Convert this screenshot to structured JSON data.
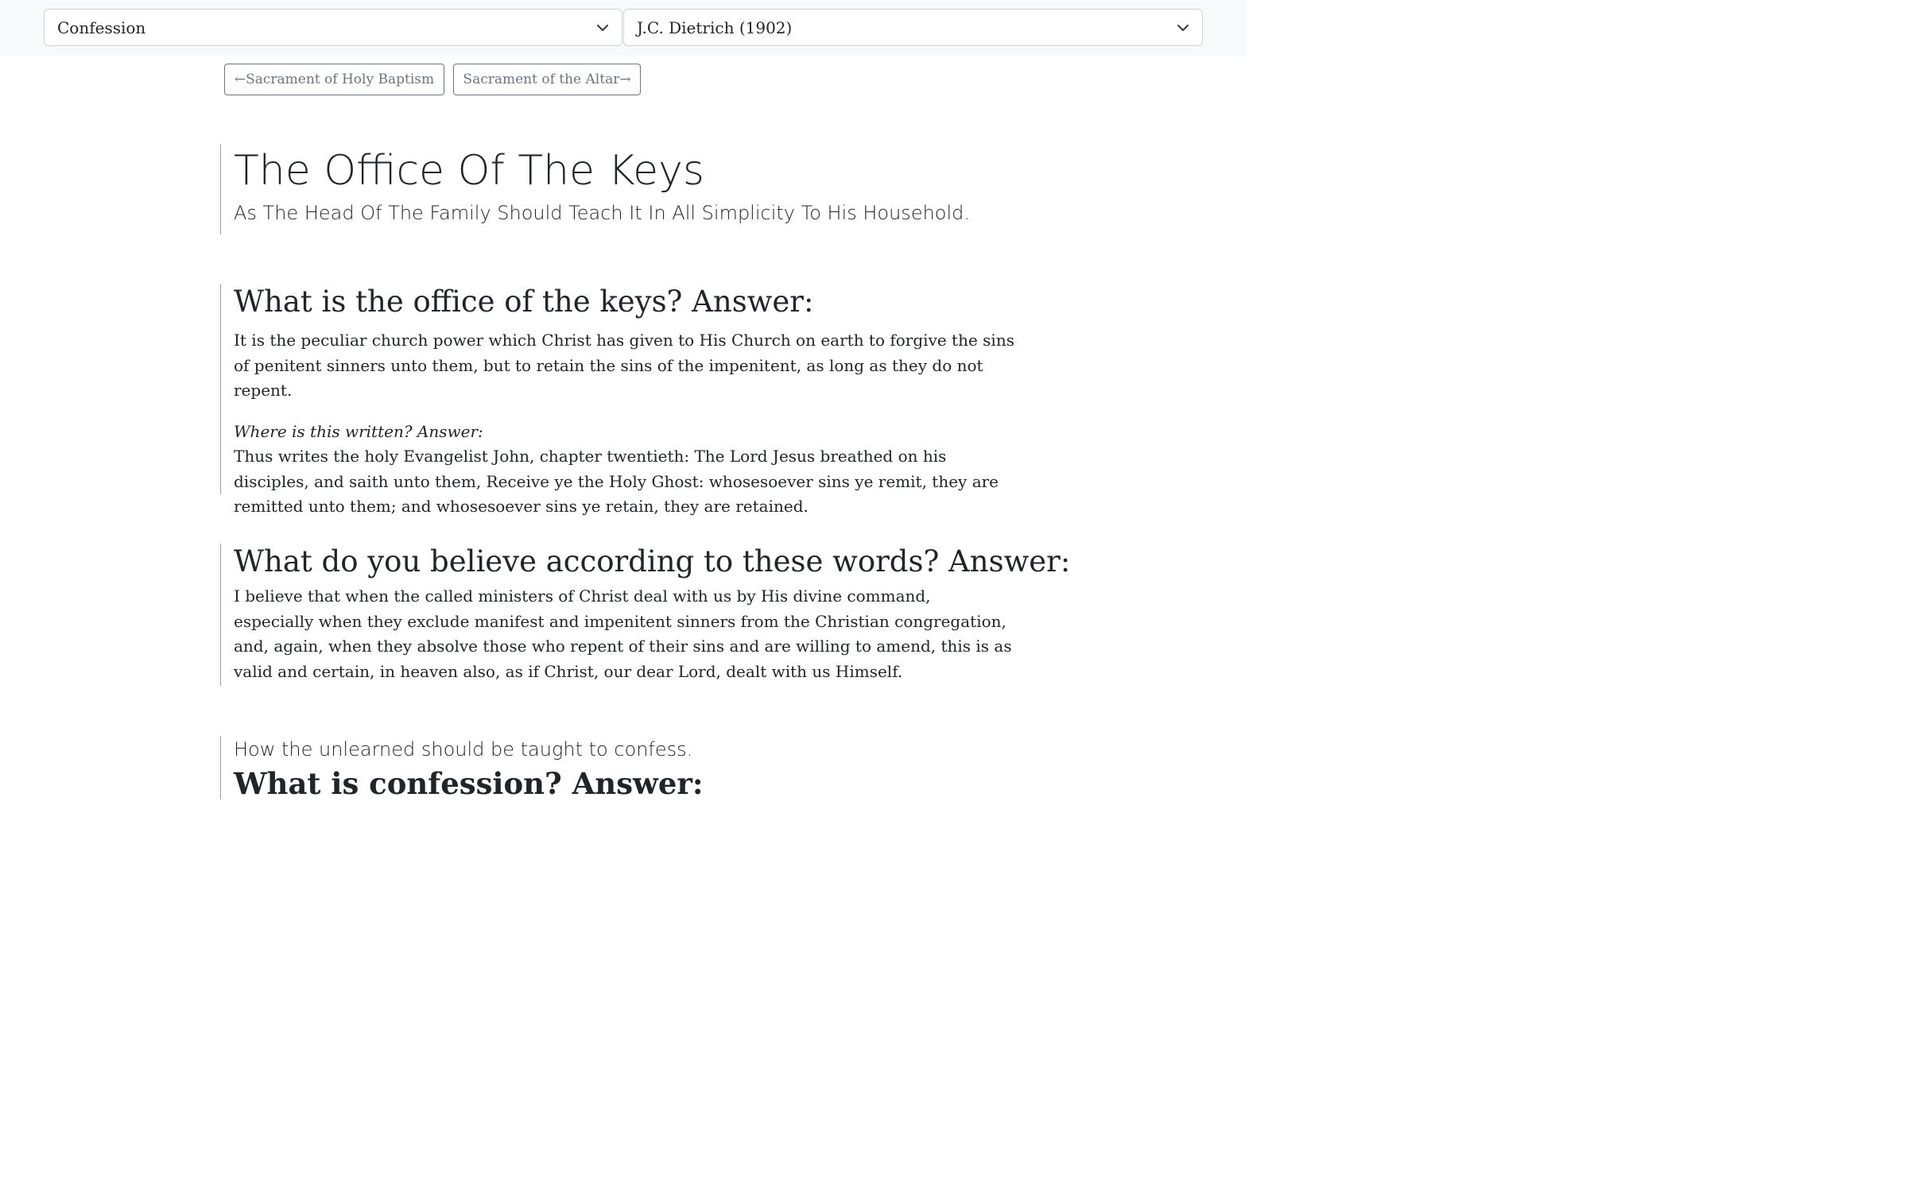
{
  "selectors": {
    "section": "Confession",
    "translation": "J.C. Dietrich (1902)"
  },
  "nav": {
    "prev": "←Sacrament of Holy Baptism",
    "next": "Sacrament of the Altar→"
  },
  "header": {
    "title": "The Office Of The Keys",
    "subtitle": "As The Head Of The Family Should Teach It In All Simplicity To His Household."
  },
  "sections": [
    {
      "question": "What is the office of the keys? Answer:",
      "answer": "It is the peculiar church power which Christ has given to His Church on earth to forgive the sins of penitent sinners unto them, but to retain the sins of the impenitent, as long as they do not repent.",
      "where_label": "Where is this written? Answer:",
      "where_text": "Thus writes the holy Evangelist John, chapter twentieth: The Lord Jesus breathed on his disciples, and saith unto them, Receive ye the Holy Ghost: whosesoever sins ye remit, they are remitted unto them; and whosesoever sins ye retain, they are retained."
    },
    {
      "question": "What do you believe according to these words? Answer:",
      "answer": "I believe that when the called ministers of Christ deal with us by His divine command, especially when they exclude manifest and impenitent sinners from the Christian congregation, and, again, when they absolve those who repent of their sins and are willing to amend, this is as valid and certain, in heaven also, as if Christ, our dear Lord, dealt with us Himself."
    },
    {
      "intro": "How the unlearned should be taught to confess.",
      "question": "What is confession? Answer:"
    }
  ],
  "colors": {
    "text": "#212529",
    "muted": "#6c757d",
    "topbar_bg": "#f8f9fa",
    "border": "#ced4da"
  },
  "icons": {
    "select_chevron": "chevron-down-icon"
  }
}
